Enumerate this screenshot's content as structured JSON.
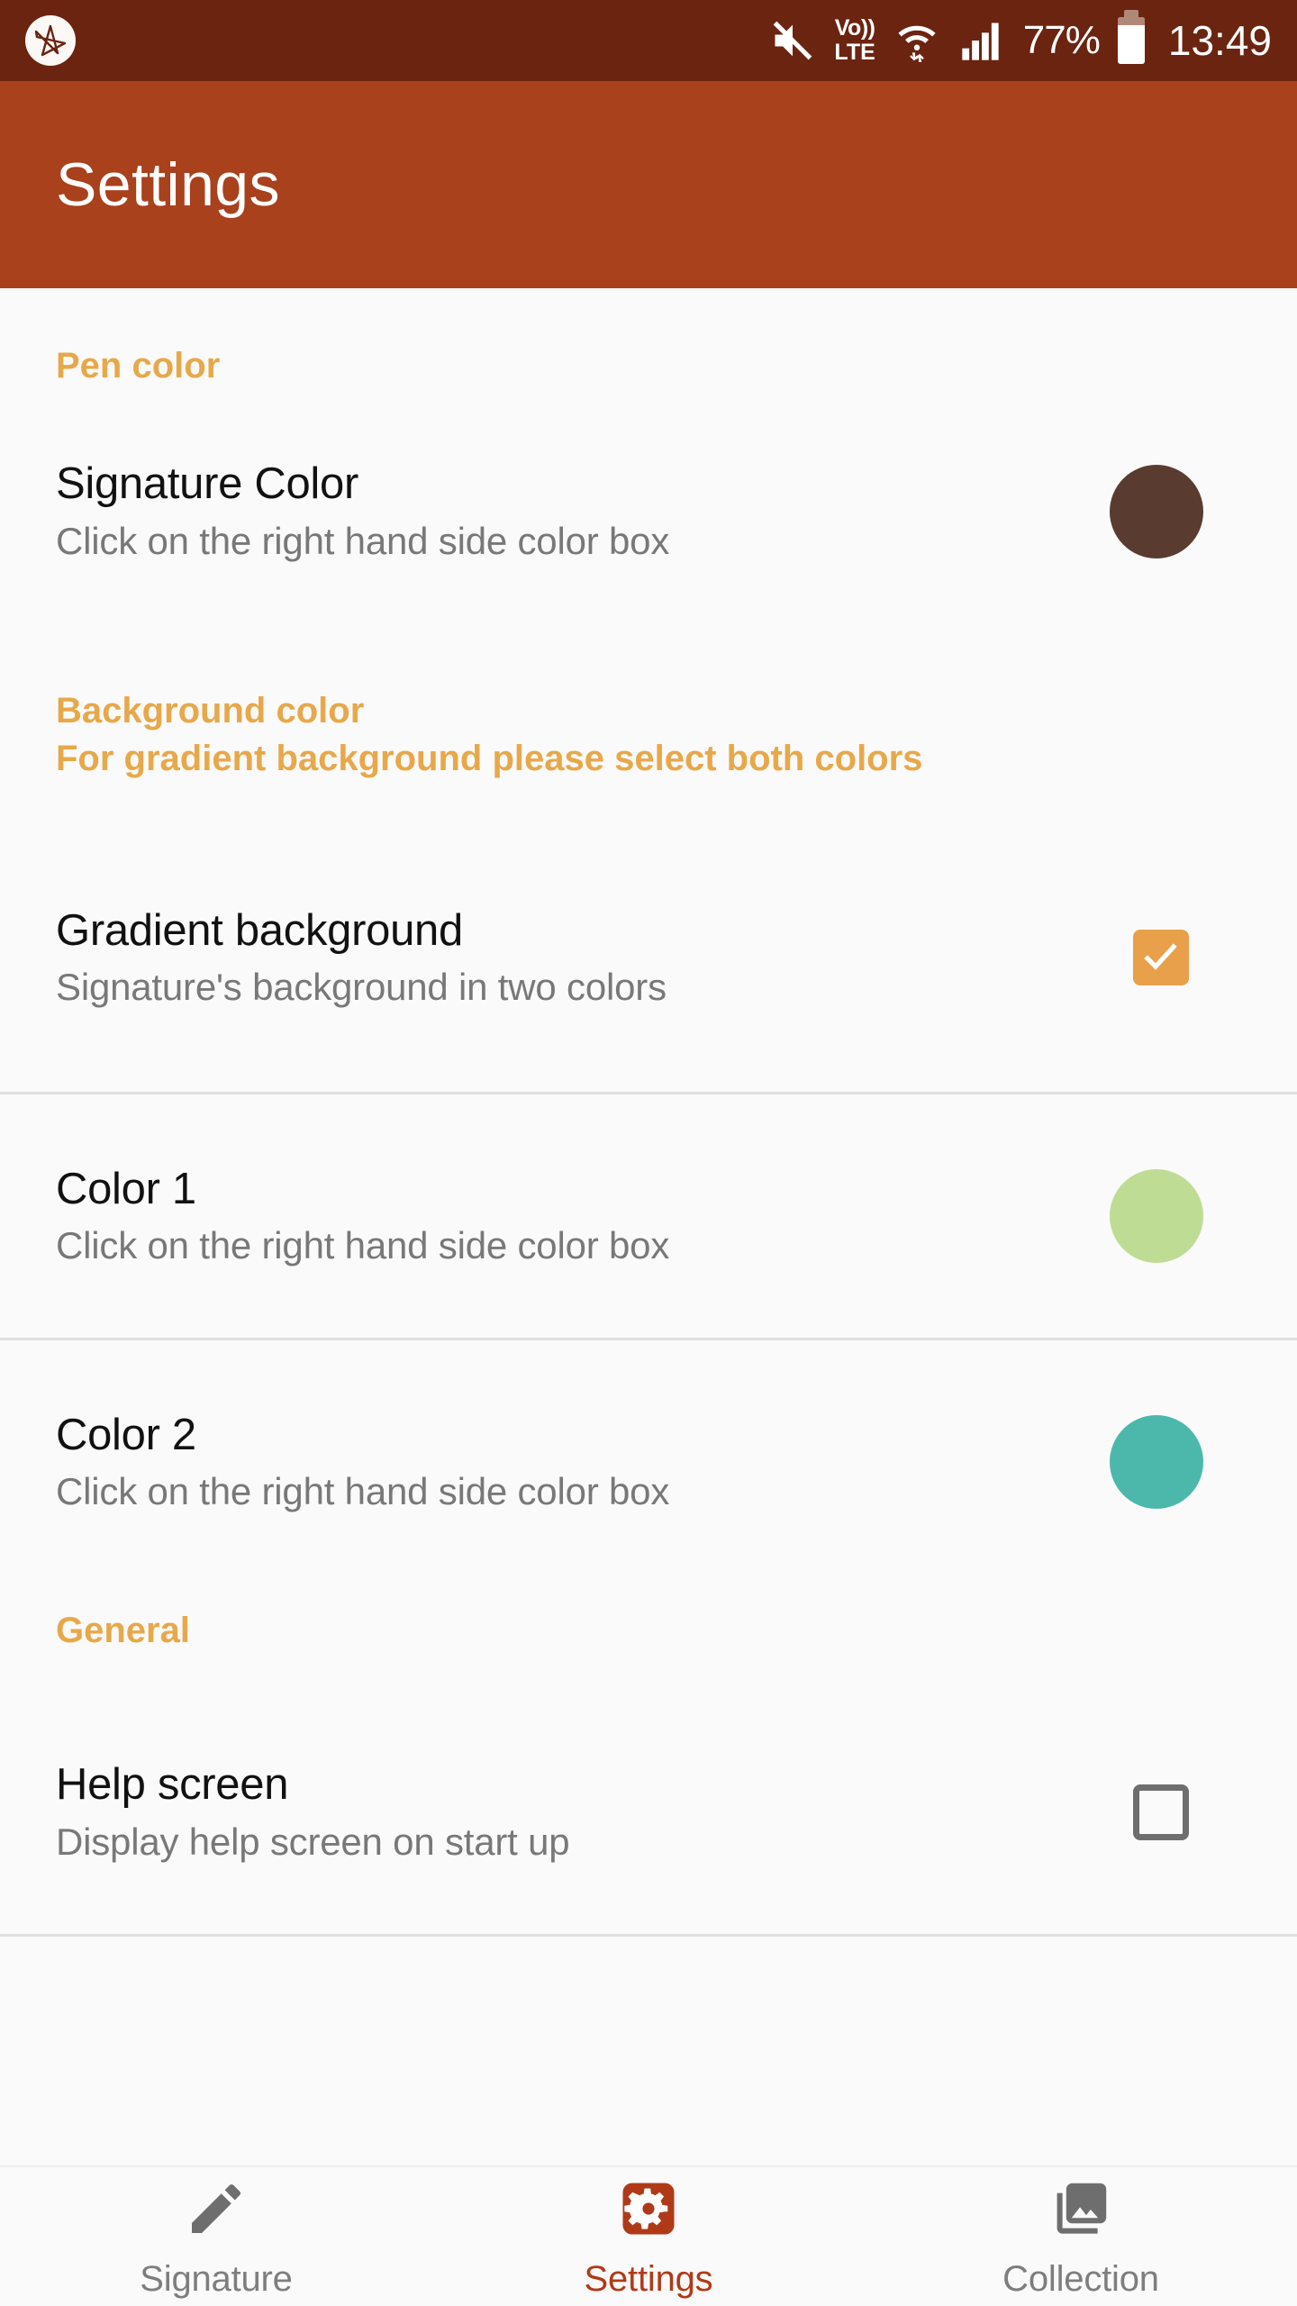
{
  "status_bar": {
    "app_icon": "signature-star-icon",
    "icons": [
      "mute-icon",
      "volte-icon",
      "wifi-icon",
      "signal-bars-icon",
      "battery-icon"
    ],
    "volte_line1": "Vo))",
    "volte_line2": "LTE",
    "battery_percent": "77%",
    "time": "13:49",
    "background_color": "#6B2410"
  },
  "app_bar": {
    "title": "Settings",
    "background_color": "#A8411C",
    "text_color": "#FFFFFF"
  },
  "sections": {
    "pen_color": {
      "header": "Pen color",
      "rows": [
        {
          "title": "Signature Color",
          "summary": "Click on the right hand side color box",
          "swatch_color": "#5A3B30"
        }
      ]
    },
    "background_color": {
      "header_line1": "Background color",
      "header_line2": "For gradient background please select both colors",
      "rows": [
        {
          "title": "Gradient background",
          "summary": "Signature's background in two colors",
          "checked": true,
          "checkbox_color": "#E8A04A"
        },
        {
          "title": "Color 1",
          "summary": "Click on the right hand side color box",
          "swatch_color": "#BEDC94"
        },
        {
          "title": "Color 2",
          "summary": "Click on the right hand side color box",
          "swatch_color": "#4CB8AC"
        }
      ]
    },
    "general": {
      "header": "General",
      "rows": [
        {
          "title": "Help screen",
          "summary": "Display help screen on start up",
          "checked": false,
          "checkbox_color": "#6E6E6E"
        }
      ]
    }
  },
  "bottom_nav": {
    "items": [
      {
        "label": "Signature",
        "icon": "pencil-icon",
        "active": false
      },
      {
        "label": "Settings",
        "icon": "gear-icon",
        "active": true
      },
      {
        "label": "Collection",
        "icon": "photo-library-icon",
        "active": false
      }
    ],
    "active_color": "#B03A18",
    "inactive_color": "#7E7E7E"
  },
  "theme": {
    "accent_orange": "#E8A84A",
    "page_background": "#FAFAFA",
    "divider": "#E0E0E0"
  }
}
